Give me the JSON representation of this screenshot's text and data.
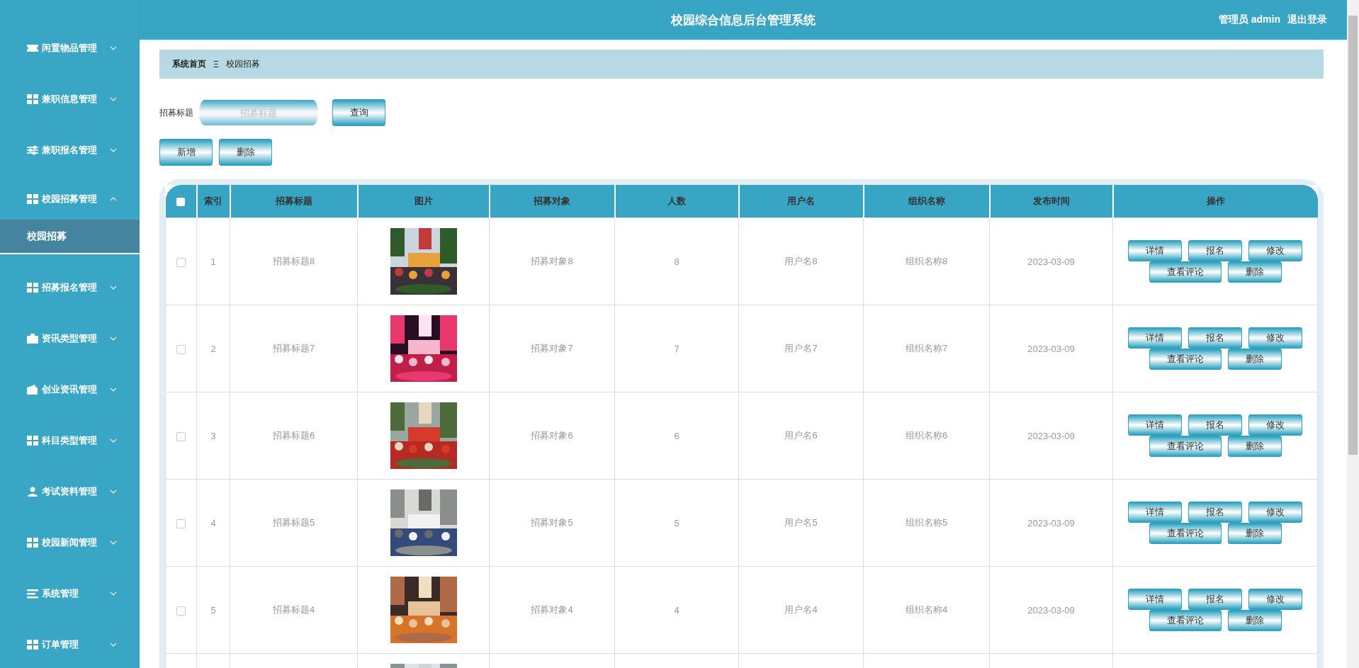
{
  "sidebar": {
    "items": [
      {
        "label": "闲置物品管理",
        "expanded": false
      },
      {
        "label": "兼职信息管理",
        "expanded": false
      },
      {
        "label": "兼职报名管理",
        "expanded": false
      },
      {
        "label": "校园招募管理",
        "expanded": true,
        "children": [
          {
            "label": "校园招募",
            "selected": true
          }
        ]
      },
      {
        "label": "招募报名管理",
        "expanded": false
      },
      {
        "label": "资讯类型管理",
        "expanded": false
      },
      {
        "label": "创业资讯管理",
        "expanded": false
      },
      {
        "label": "科目类型管理",
        "expanded": false
      },
      {
        "label": "考试资料管理",
        "expanded": false
      },
      {
        "label": "校园新闻管理",
        "expanded": false
      },
      {
        "label": "系统管理",
        "expanded": false
      },
      {
        "label": "订单管理",
        "expanded": false
      }
    ]
  },
  "header": {
    "title": "校园综合信息后台管理系统",
    "user": "管理员 admin",
    "logout": "退出登录"
  },
  "breadcrumb": {
    "home": "系统首页",
    "separator": "Ξ",
    "current": "校园招募"
  },
  "search": {
    "label": "招募标题",
    "placeholder": "招募标题",
    "button": "查询"
  },
  "toolbar": [
    "新增",
    "删除"
  ],
  "table": {
    "all_checked": false,
    "columns": [
      "索引",
      "招募标题",
      "图片",
      "招募对象",
      "人数",
      "用户名",
      "组织名称",
      "发布时间",
      "操作"
    ],
    "rows": [
      {
        "checked": false,
        "index": "1",
        "title": "招募标题8",
        "picture": {
          "kind": "picture"
        },
        "target": "招募对象8",
        "count": "8",
        "username": "用户名8",
        "org": "组织名称8",
        "date": "2023-03-09",
        "actions": [
          "详情",
          "报名",
          "修改",
          "查看评论",
          "删除"
        ]
      },
      {
        "checked": false,
        "index": "2",
        "title": "招募标题7",
        "picture": {
          "kind": "picture"
        },
        "target": "招募对象7",
        "count": "7",
        "username": "用户名7",
        "org": "组织名称7",
        "date": "2023-03-09",
        "actions": [
          "详情",
          "报名",
          "修改",
          "查看评论",
          "删除"
        ]
      },
      {
        "checked": false,
        "index": "3",
        "title": "招募标题6",
        "picture": {
          "kind": "picture"
        },
        "target": "招募对象6",
        "count": "6",
        "username": "用户名6",
        "org": "组织名称6",
        "date": "2023-03-09",
        "actions": [
          "详情",
          "报名",
          "修改",
          "查看评论",
          "删除"
        ]
      },
      {
        "checked": false,
        "index": "4",
        "title": "招募标题5",
        "picture": {
          "kind": "picture"
        },
        "target": "招募对象5",
        "count": "5",
        "username": "用户名5",
        "org": "组织名称5",
        "date": "2023-03-09",
        "actions": [
          "详情",
          "报名",
          "修改",
          "查看评论",
          "删除"
        ]
      },
      {
        "checked": false,
        "index": "5",
        "title": "招募标题4",
        "picture": {
          "kind": "picture"
        },
        "target": "招募对象4",
        "count": "4",
        "username": "用户名4",
        "org": "组织名称4",
        "date": "2023-03-09",
        "actions": [
          "详情",
          "报名",
          "修改",
          "查看评论",
          "删除"
        ]
      },
      {
        "picture": {
          "kind": "picture"
        }
      }
    ]
  }
}
